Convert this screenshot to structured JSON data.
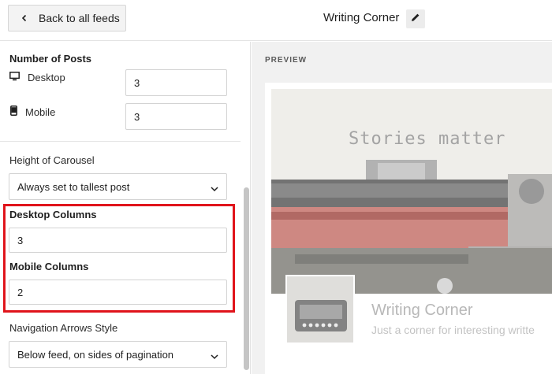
{
  "topbar": {
    "back_label": "Back to all feeds",
    "feed_title": "Writing Corner"
  },
  "sidebar": {
    "number_of_posts": {
      "label": "Number of Posts",
      "desktop_label": "Desktop",
      "desktop_value": "3",
      "mobile_label": "Mobile",
      "mobile_value": "3"
    },
    "height_of_carousel": {
      "label": "Height of Carousel",
      "selected": "Always set to tallest post"
    },
    "desktop_columns": {
      "label": "Desktop Columns",
      "value": "3"
    },
    "mobile_columns": {
      "label": "Mobile Columns",
      "value": "2"
    },
    "navigation_arrows": {
      "label": "Navigation Arrows Style",
      "selected": "Below feed, on sides of pagination"
    }
  },
  "preview": {
    "label": "PREVIEW",
    "hero_text": "Stories matter",
    "profile_name": "Writing Corner",
    "profile_bio": "Just a corner for interesting writte"
  },
  "colors": {
    "highlight": "#e0141b",
    "preview_bg": "#f1f1f1",
    "strap_red": "#b5423a"
  },
  "icons": [
    "chevron-left-icon",
    "pencil-icon",
    "monitor-icon",
    "phone-icon",
    "chevron-down-icon"
  ]
}
